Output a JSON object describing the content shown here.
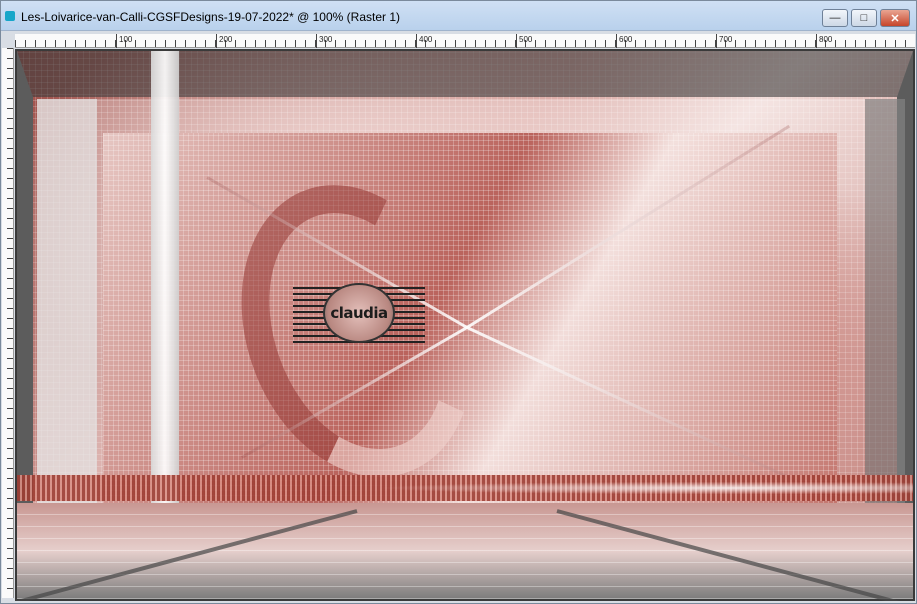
{
  "window": {
    "title": "Les-Loivarice-van-Calli-CGSFDesigns-19-07-2022* @ 100% (Raster 1)",
    "minimize_label": "—",
    "maximize_label": "□",
    "close_label": "✕"
  },
  "ruler": {
    "ticks": [
      "100",
      "200",
      "300",
      "400",
      "500",
      "600",
      "700",
      "800"
    ]
  },
  "canvas": {
    "zoom": "100%",
    "layer": "Raster 1",
    "watermark_text": "claudia"
  },
  "colors": {
    "titlebar": "#c4d9f0",
    "art_red": "#9b4b45",
    "art_pink": "#f1dcd9"
  }
}
